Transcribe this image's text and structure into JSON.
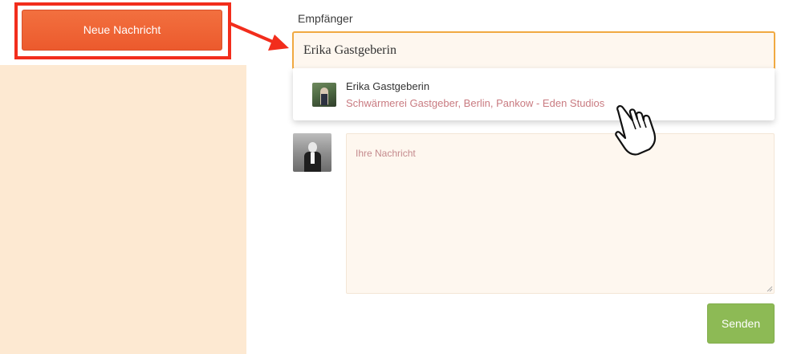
{
  "sidebar": {
    "new_message_label": "Neue Nachricht"
  },
  "form": {
    "recipient_label": "Empfänger",
    "recipient_value": "Erika Gastgeberin",
    "suggestion": {
      "name": "Erika Gastgeberin",
      "detail": "Schwärmerei Gastgeber, Berlin, Pankow - Eden Studios"
    },
    "message_placeholder": "Ihre Nachricht",
    "send_label": "Senden"
  },
  "colors": {
    "accent_orange": "#ec5a2d",
    "highlight_red": "#f22d1c",
    "sidebar_bg": "#fde9d2",
    "input_focus": "#f0a941",
    "send_green": "#8dba55"
  },
  "icons": {
    "annotation_arrow": "arrow-right-icon",
    "pointer": "hand-pointer-icon"
  }
}
